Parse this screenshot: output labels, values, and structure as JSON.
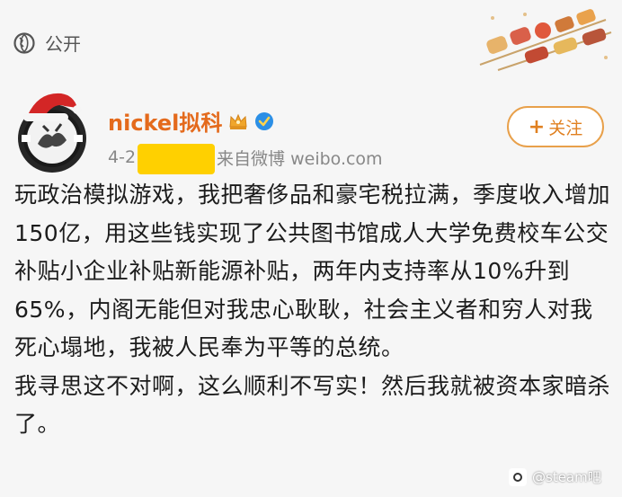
{
  "privacy": {
    "label": "公开",
    "icon": "globe-icon"
  },
  "author": {
    "name": "nickel拟科",
    "badges": [
      "crown-icon",
      "verified-icon"
    ],
    "date": "4-2",
    "source": "来自微博 weibo.com",
    "source_visible": "来自微博 weibo.com"
  },
  "follow": {
    "label": "关注"
  },
  "post": {
    "paragraph1": "玩政治模拟游戏，我把奢侈品和豪宅税拉满，季度收入增加150亿，用这些钱实现了公共图书馆成人大学免费校车公交补贴小企业补贴新能源补贴，两年内支持率从10%升到65%，内阁无能但对我忠心耿耿，社会主义者和穷人对我死心塌地，我被人民奉为平等的总统。",
    "paragraph2": "我寻思这不对啊，这么顺利不写实！然后我就被资本家暗杀了。"
  },
  "watermark": {
    "label": "@steam吧"
  },
  "colors": {
    "username": "#e46a1c",
    "follow_border": "#e8a04a",
    "redaction": "#ffd000"
  }
}
